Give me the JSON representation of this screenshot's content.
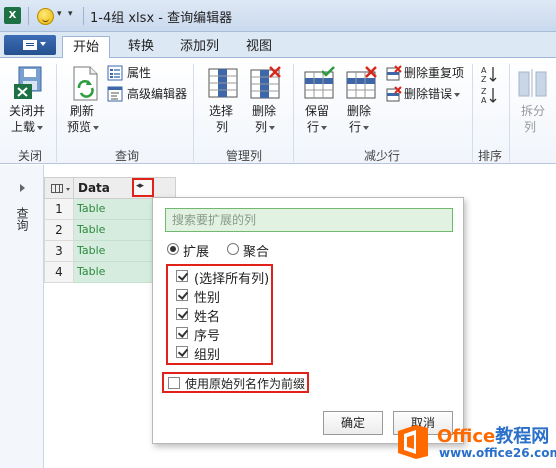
{
  "window": {
    "app_badge": "X",
    "title": "1-4组 xlsx - 查询编辑器"
  },
  "tabs": [
    {
      "label": "开始",
      "active": true
    },
    {
      "label": "转换"
    },
    {
      "label": "添加列"
    },
    {
      "label": "视图"
    }
  ],
  "ribbon": {
    "close_load": {
      "line1": "关闭并",
      "line2": "上载"
    },
    "refresh": {
      "line1": "刷新",
      "line2": "预览"
    },
    "properties": "属性",
    "advanced_editor": "高级编辑器",
    "choose_columns": {
      "line1": "选择",
      "line2": "列"
    },
    "remove_columns": {
      "line1": "删除",
      "line2": "列"
    },
    "keep_rows": {
      "line1": "保留",
      "line2": "行"
    },
    "remove_rows": {
      "line1": "删除",
      "line2": "行"
    },
    "remove_duplicates": "删除重复项",
    "remove_errors": "删除错误",
    "split": {
      "line1": "拆分",
      "line2": "列"
    },
    "groups": {
      "close": "关闭",
      "query": "查询",
      "manage_columns": "管理列",
      "reduce_rows": "减少行",
      "sort": "排序"
    }
  },
  "query_pane": {
    "label": "查询"
  },
  "grid": {
    "column_header": "Data",
    "rows": [
      {
        "num": "1",
        "value": "Table"
      },
      {
        "num": "2",
        "value": "Table"
      },
      {
        "num": "3",
        "value": "Table"
      },
      {
        "num": "4",
        "value": "Table"
      }
    ]
  },
  "popup": {
    "search_placeholder": "搜索要扩展的列",
    "mode_expand": "扩展",
    "mode_aggregate": "聚合",
    "columns": [
      {
        "label": "(选择所有列)",
        "checked": true
      },
      {
        "label": "性别",
        "checked": true
      },
      {
        "label": "姓名",
        "checked": true
      },
      {
        "label": "序号",
        "checked": true
      },
      {
        "label": "组别",
        "checked": true
      }
    ],
    "use_prefix": {
      "label": "使用原始列名作为前缀",
      "checked": false
    },
    "ok_label": "确定",
    "cancel_label": "取消"
  },
  "watermark": {
    "line1_a": "Office",
    "line1_b": "教程网",
    "line2": "www.office26.com"
  },
  "colors": {
    "accent_red": "#e0221b",
    "table_green": "#2d8a3e",
    "title_bar": "#d6e3f3"
  }
}
